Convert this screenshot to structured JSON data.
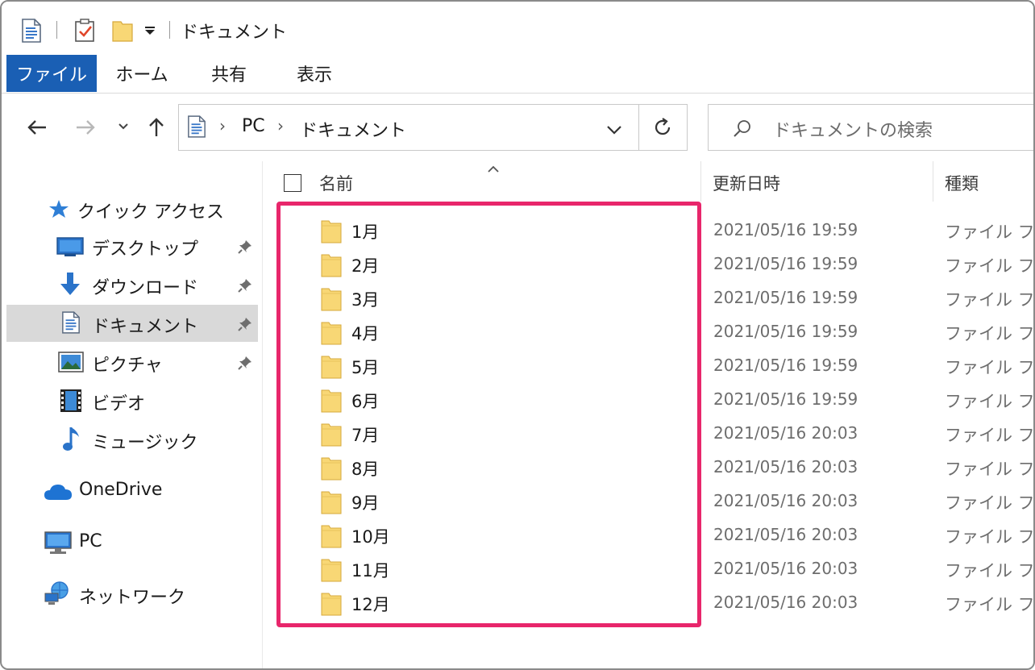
{
  "window": {
    "title": "ドキュメント"
  },
  "ribbon": {
    "tabs": [
      "ファイル",
      "ホーム",
      "共有",
      "表示"
    ]
  },
  "address": {
    "crumbs": [
      "PC",
      "ドキュメント"
    ]
  },
  "search": {
    "placeholder": "ドキュメントの検索"
  },
  "sidebar": {
    "quick_access": "クイック アクセス",
    "items": [
      {
        "label": "デスクトップ",
        "icon": "desktop-icon",
        "pinned": true
      },
      {
        "label": "ダウンロード",
        "icon": "download-icon",
        "pinned": true
      },
      {
        "label": "ドキュメント",
        "icon": "document-icon",
        "pinned": true,
        "selected": true
      },
      {
        "label": "ピクチャ",
        "icon": "pictures-icon",
        "pinned": true
      },
      {
        "label": "ビデオ",
        "icon": "video-icon",
        "pinned": false
      },
      {
        "label": "ミュージック",
        "icon": "music-icon",
        "pinned": false
      }
    ],
    "onedrive": "OneDrive",
    "pc": "PC",
    "network": "ネットワーク"
  },
  "columns": {
    "name": "名前",
    "date": "更新日時",
    "type": "種類"
  },
  "files": [
    {
      "name": "1月",
      "date": "2021/05/16 19:59",
      "type": "ファイル フォル"
    },
    {
      "name": "2月",
      "date": "2021/05/16 19:59",
      "type": "ファイル フォル"
    },
    {
      "name": "3月",
      "date": "2021/05/16 19:59",
      "type": "ファイル フォル"
    },
    {
      "name": "4月",
      "date": "2021/05/16 19:59",
      "type": "ファイル フォル"
    },
    {
      "name": "5月",
      "date": "2021/05/16 19:59",
      "type": "ファイル フォル"
    },
    {
      "name": "6月",
      "date": "2021/05/16 19:59",
      "type": "ファイル フォル"
    },
    {
      "name": "7月",
      "date": "2021/05/16 20:03",
      "type": "ファイル フォル"
    },
    {
      "name": "8月",
      "date": "2021/05/16 20:03",
      "type": "ファイル フォル"
    },
    {
      "name": "9月",
      "date": "2021/05/16 20:03",
      "type": "ファイル フォル"
    },
    {
      "name": "10月",
      "date": "2021/05/16 20:03",
      "type": "ファイル フォル"
    },
    {
      "name": "11月",
      "date": "2021/05/16 20:03",
      "type": "ファイル フォル"
    },
    {
      "name": "12月",
      "date": "2021/05/16 20:03",
      "type": "ファイル フォル"
    }
  ],
  "colors": {
    "accent": "#1a5fb4",
    "highlight": "#e8266b",
    "folder": "#f8d775"
  }
}
